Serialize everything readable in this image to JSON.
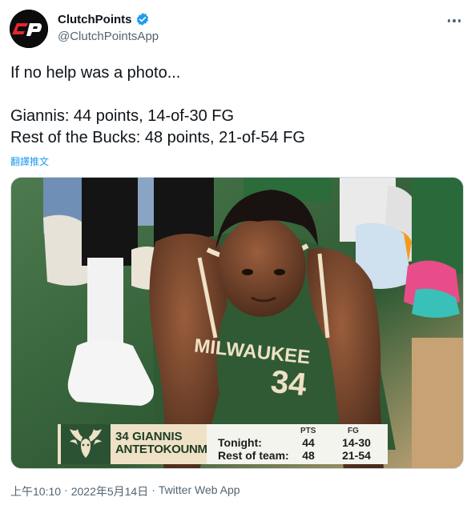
{
  "author": {
    "display_name": "ClutchPoints",
    "handle": "@ClutchPointsApp",
    "avatar_text": "CP"
  },
  "tweet": {
    "line1": "If no help was a photo...",
    "line2": "Giannis: 44 points, 14-of-30 FG",
    "line3": "Rest of the Bucks: 48 points, 21-of-54 FG",
    "translate_label": "翻譯推文"
  },
  "score_bug": {
    "jersey_number": "34",
    "first_name": "GIANNIS",
    "last_name": "ANTETOKOUNMPO",
    "col_pts": "PTS",
    "col_fg": "FG",
    "row1_label": "Tonight:",
    "row1_pts": "44",
    "row1_fg": "14-30",
    "row2_label": "Rest of team:",
    "row2_pts": "48",
    "row2_fg": "21-54"
  },
  "jersey_text": "MILWAUKEE",
  "jersey_number_big": "34",
  "footer": {
    "time": "上午10:10",
    "sep1": "·",
    "date": "2022年5月14日",
    "sep2": "·",
    "source": "Twitter Web App"
  },
  "colors": {
    "bucks_green": "#2c5234",
    "bucks_cream": "#eee1c6",
    "link_blue": "#1d9bf0",
    "muted_gray": "#536471"
  }
}
